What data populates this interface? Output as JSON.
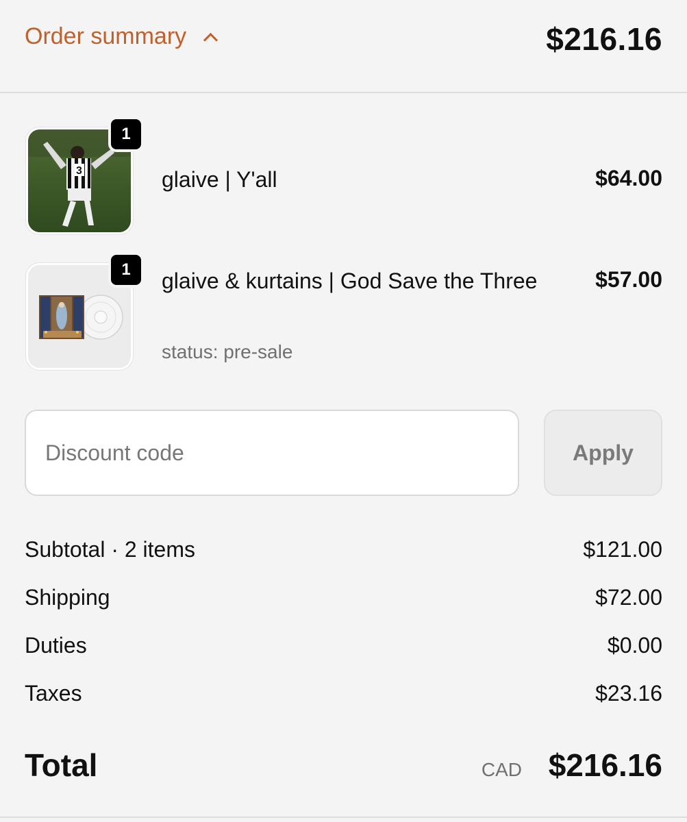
{
  "header": {
    "toggle_label": "Order summary",
    "total": "$216.16"
  },
  "items": [
    {
      "name": "glaive | Y'all",
      "quantity": "1",
      "price": "$64.00",
      "status": ""
    },
    {
      "name": "glaive & kurtains | God Save the Three",
      "quantity": "1",
      "price": "$57.00",
      "status": "status: pre-sale"
    }
  ],
  "discount": {
    "placeholder": "Discount code",
    "value": "",
    "apply_label": "Apply"
  },
  "costs": {
    "subtotal_label": "Subtotal · 2 items",
    "subtotal_value": "$121.00",
    "shipping_label": "Shipping",
    "shipping_value": "$72.00",
    "duties_label": "Duties",
    "duties_value": "$0.00",
    "taxes_label": "Taxes",
    "taxes_value": "$23.16"
  },
  "total": {
    "label": "Total",
    "currency": "CAD",
    "value": "$216.16"
  },
  "colors": {
    "accent": "#c0602a",
    "background": "#f4f4f4"
  }
}
